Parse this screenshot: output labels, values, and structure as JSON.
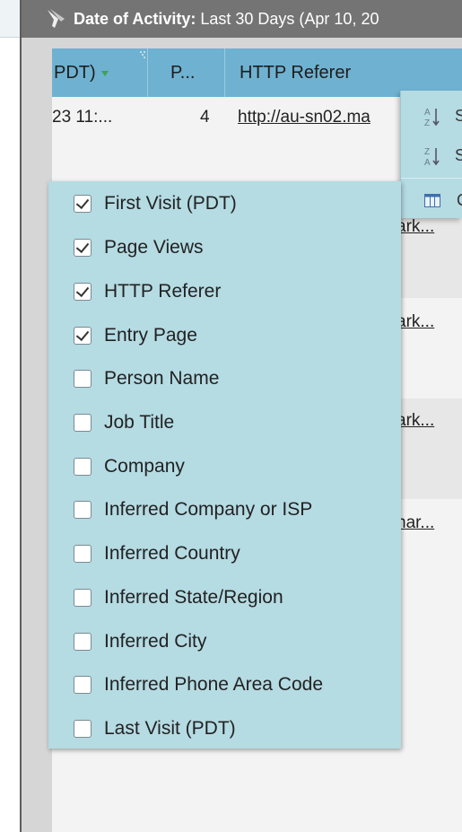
{
  "filter_bar": {
    "label": "Date of Activity:",
    "value": " Last 30 Days (Apr 10, 20"
  },
  "grid": {
    "columns": [
      {
        "label": "PDT)"
      },
      {
        "label": "P..."
      },
      {
        "label": "HTTP Referer"
      }
    ],
    "rows": [
      {
        "first_visit": "23 11:...",
        "page_views": "4",
        "referer": "http://au-sn02.ma"
      }
    ],
    "peek_links": [
      "ark...",
      "ark...",
      "ark...",
      "nar..."
    ]
  },
  "context_menu": {
    "items": [
      {
        "label": "S",
        "icon": "sort-ascending-icon"
      },
      {
        "label": "S",
        "icon": "sort-descending-icon"
      },
      {
        "label": "C",
        "icon": "columns-icon"
      }
    ]
  },
  "column_chooser": {
    "options": [
      {
        "label": "First Visit (PDT)",
        "checked": true
      },
      {
        "label": "Page Views",
        "checked": true
      },
      {
        "label": "HTTP Referer",
        "checked": true
      },
      {
        "label": "Entry Page",
        "checked": true
      },
      {
        "label": "Person Name",
        "checked": false
      },
      {
        "label": "Job Title",
        "checked": false
      },
      {
        "label": "Company",
        "checked": false
      },
      {
        "label": "Inferred Company or ISP",
        "checked": false
      },
      {
        "label": "Inferred Country",
        "checked": false
      },
      {
        "label": "Inferred State/Region",
        "checked": false
      },
      {
        "label": "Inferred City",
        "checked": false
      },
      {
        "label": "Inferred Phone Area Code",
        "checked": false
      },
      {
        "label": "Last Visit (PDT)",
        "checked": false
      }
    ]
  },
  "colors": {
    "header_blue": "#6fb1d0",
    "menu_bg": "#b5dbe3",
    "filter_bar_bg": "#747474",
    "sort_arrow_green": "#3fa24e"
  }
}
